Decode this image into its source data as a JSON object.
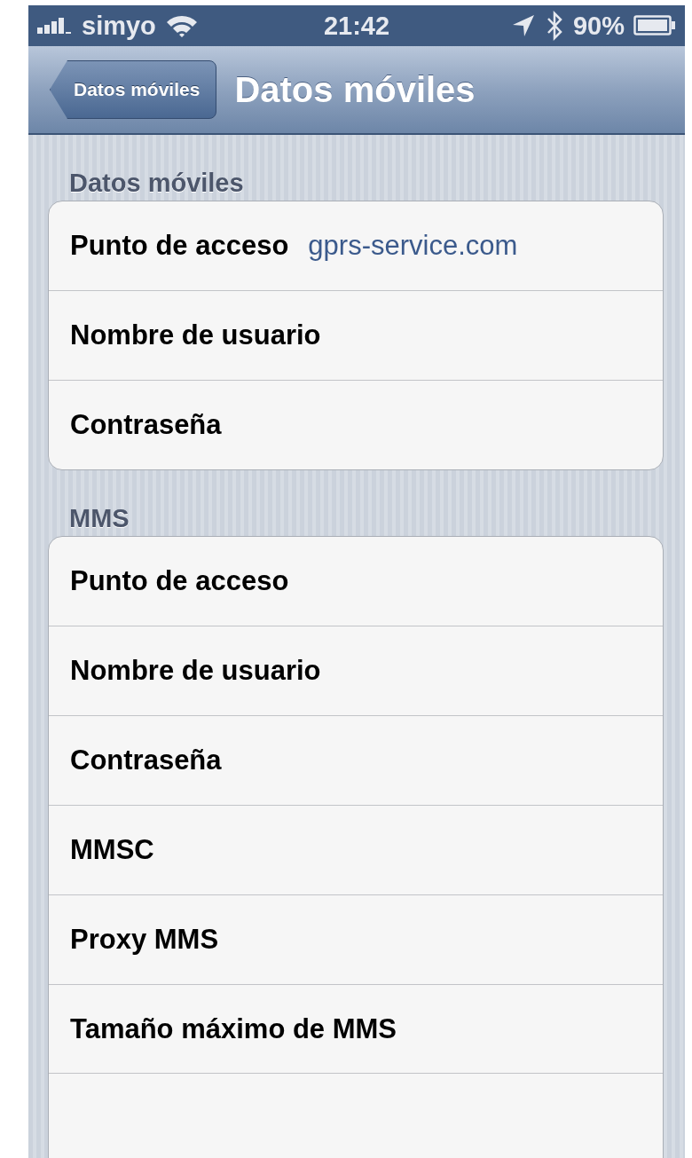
{
  "status_bar": {
    "carrier": "simyo",
    "time": "21:42",
    "battery_percent": "90%"
  },
  "nav_bar": {
    "back_button": "Datos móviles",
    "title": "Datos móviles"
  },
  "sections": [
    {
      "header": "Datos móviles",
      "rows": [
        {
          "label": "Punto de acceso",
          "value": "gprs-service.com"
        },
        {
          "label": "Nombre de usuario"
        },
        {
          "label": "Contraseña"
        }
      ]
    },
    {
      "header": "MMS",
      "rows": [
        {
          "label": "Punto de acceso"
        },
        {
          "label": "Nombre de usuario"
        },
        {
          "label": "Contraseña"
        },
        {
          "label": "MMSC"
        },
        {
          "label": "Proxy MMS"
        },
        {
          "label": "Tamaño máximo de MMS"
        }
      ]
    }
  ]
}
